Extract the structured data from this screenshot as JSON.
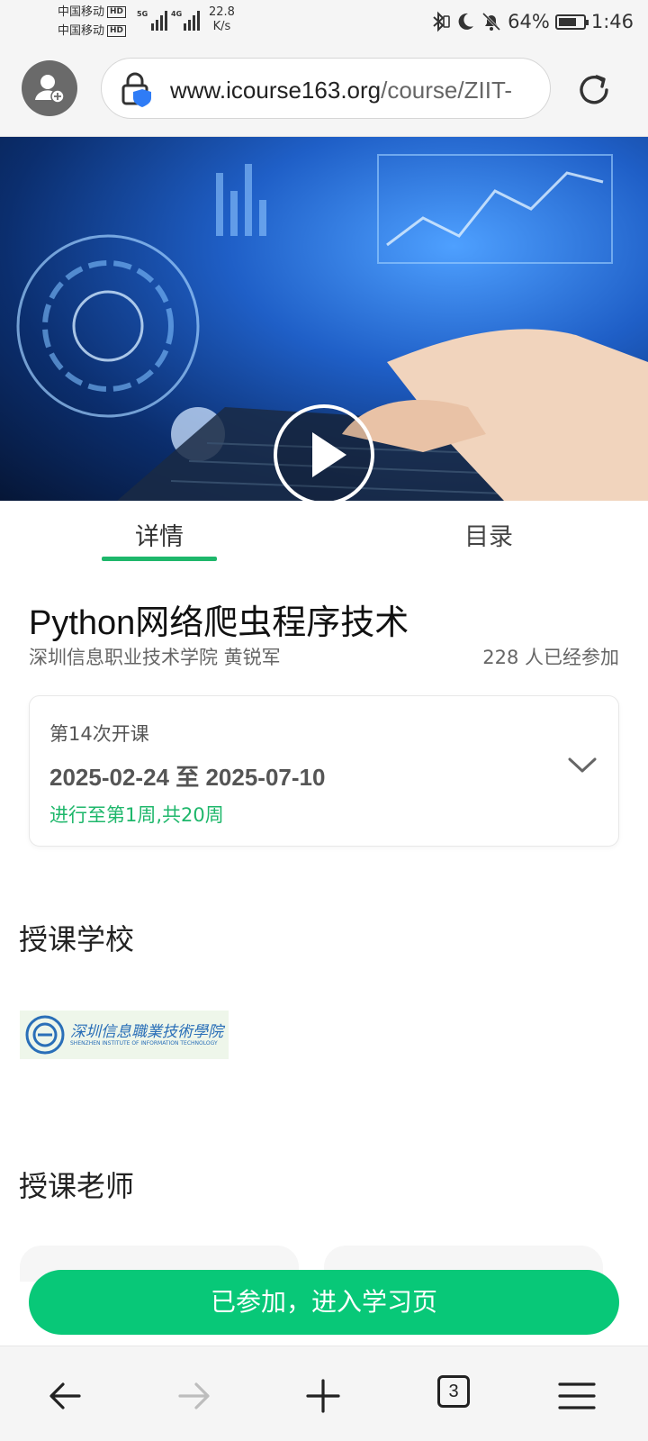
{
  "status_bar": {
    "carrier_1": "中国移动",
    "carrier_2": "中国移动",
    "hd": "HD",
    "net_1": "5G",
    "net_2": "4G",
    "speed_value": "22.8",
    "speed_unit": "K/s",
    "battery": "64%",
    "battery_level": 0.64,
    "time": "1:46",
    "icons": [
      "bluetooth-icon",
      "moon-icon",
      "bell-off-icon",
      "battery-icon"
    ]
  },
  "browser": {
    "url_host": "www.icourse163.org",
    "url_path": "/course/ZIIT-",
    "icons": [
      "profile-add-icon",
      "secure-lock-icon",
      "reload-icon"
    ]
  },
  "banner": {
    "icon": "play-icon"
  },
  "tabs": [
    {
      "label": "详情",
      "active": true
    },
    {
      "label": "目录",
      "active": false
    }
  ],
  "course": {
    "title": "Python网络爬虫程序技术",
    "school_teacher": "深圳信息职业技术学院 黄锐军",
    "enrolled": "228 人已经参加"
  },
  "session": {
    "number": "第14次开课",
    "dates": "2025-02-24 至 2025-07-10",
    "progress": "进行至第1周,共20周"
  },
  "sections": {
    "school": "授课学校",
    "teacher": "授课老师"
  },
  "school_logo": {
    "name": "深圳信息職業技術學院",
    "name_en": "SHENZHEN INSTITUTE OF INFORMATION TECHNOLOGY"
  },
  "join_button": "已参加，进入学习页",
  "bottom_nav": {
    "tab_count": "3",
    "icons": [
      "back-arrow-icon",
      "forward-arrow-icon",
      "plus-icon",
      "tabs-icon",
      "menu-icon"
    ]
  },
  "colors": {
    "accent": "#1eb76b",
    "button": "#08c878"
  }
}
